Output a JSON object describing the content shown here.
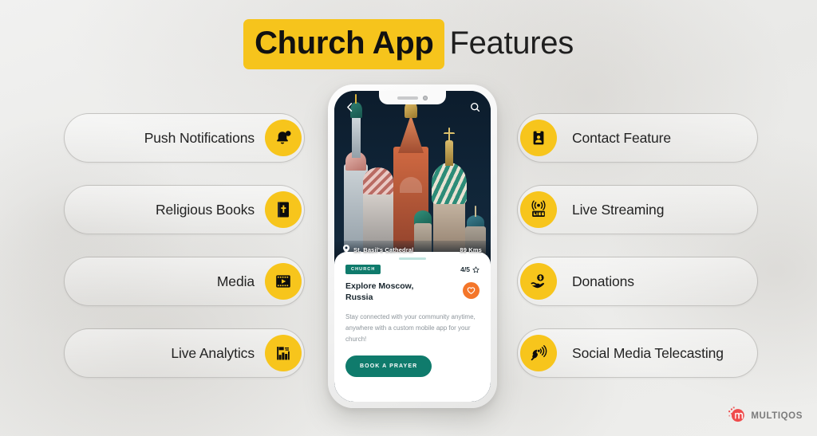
{
  "header": {
    "title_highlight": "Church App",
    "title_rest": "Features"
  },
  "colors": {
    "accent_yellow": "#f7c51c",
    "title_highlight_bg": "#f6c41c",
    "teal": "#0f7b6c",
    "orange": "#f4762a",
    "logo_red": "#ef4b4b",
    "background": "#ececeb"
  },
  "features_left": [
    {
      "label": "Push Notifications",
      "icon": "bell-icon"
    },
    {
      "label": "Religious Books",
      "icon": "bible-book-icon"
    },
    {
      "label": "Media",
      "icon": "film-play-icon"
    },
    {
      "label": "Live Analytics",
      "icon": "bar-chart-icon"
    }
  ],
  "features_right": [
    {
      "label": "Contact Feature",
      "icon": "contact-card-icon"
    },
    {
      "label": "Live Streaming",
      "icon": "live-broadcast-icon"
    },
    {
      "label": "Donations",
      "icon": "hand-coin-icon"
    },
    {
      "label": "Social Media Telecasting",
      "icon": "satellite-dish-icon"
    }
  ],
  "phone": {
    "topbar": {
      "back_icon": "chevron-left-icon",
      "search_icon": "search-icon"
    },
    "location": {
      "pin_icon": "location-pin-icon",
      "name": "St. Basil's Cathedral",
      "distance": "89 Kms"
    },
    "card": {
      "badge": "CHURCH",
      "rating": "4/5",
      "rating_icon": "star-outline-icon",
      "title": "Explore Moscow, Russia",
      "favorite_icon": "heart-icon",
      "description": "Stay connected with your community anytime, anywhere with a custom mobile app for your church!",
      "cta_label": "BOOK A PRAYER"
    }
  },
  "logo": {
    "text": "MULTIQOS",
    "mark": "multiqos-m-icon"
  }
}
